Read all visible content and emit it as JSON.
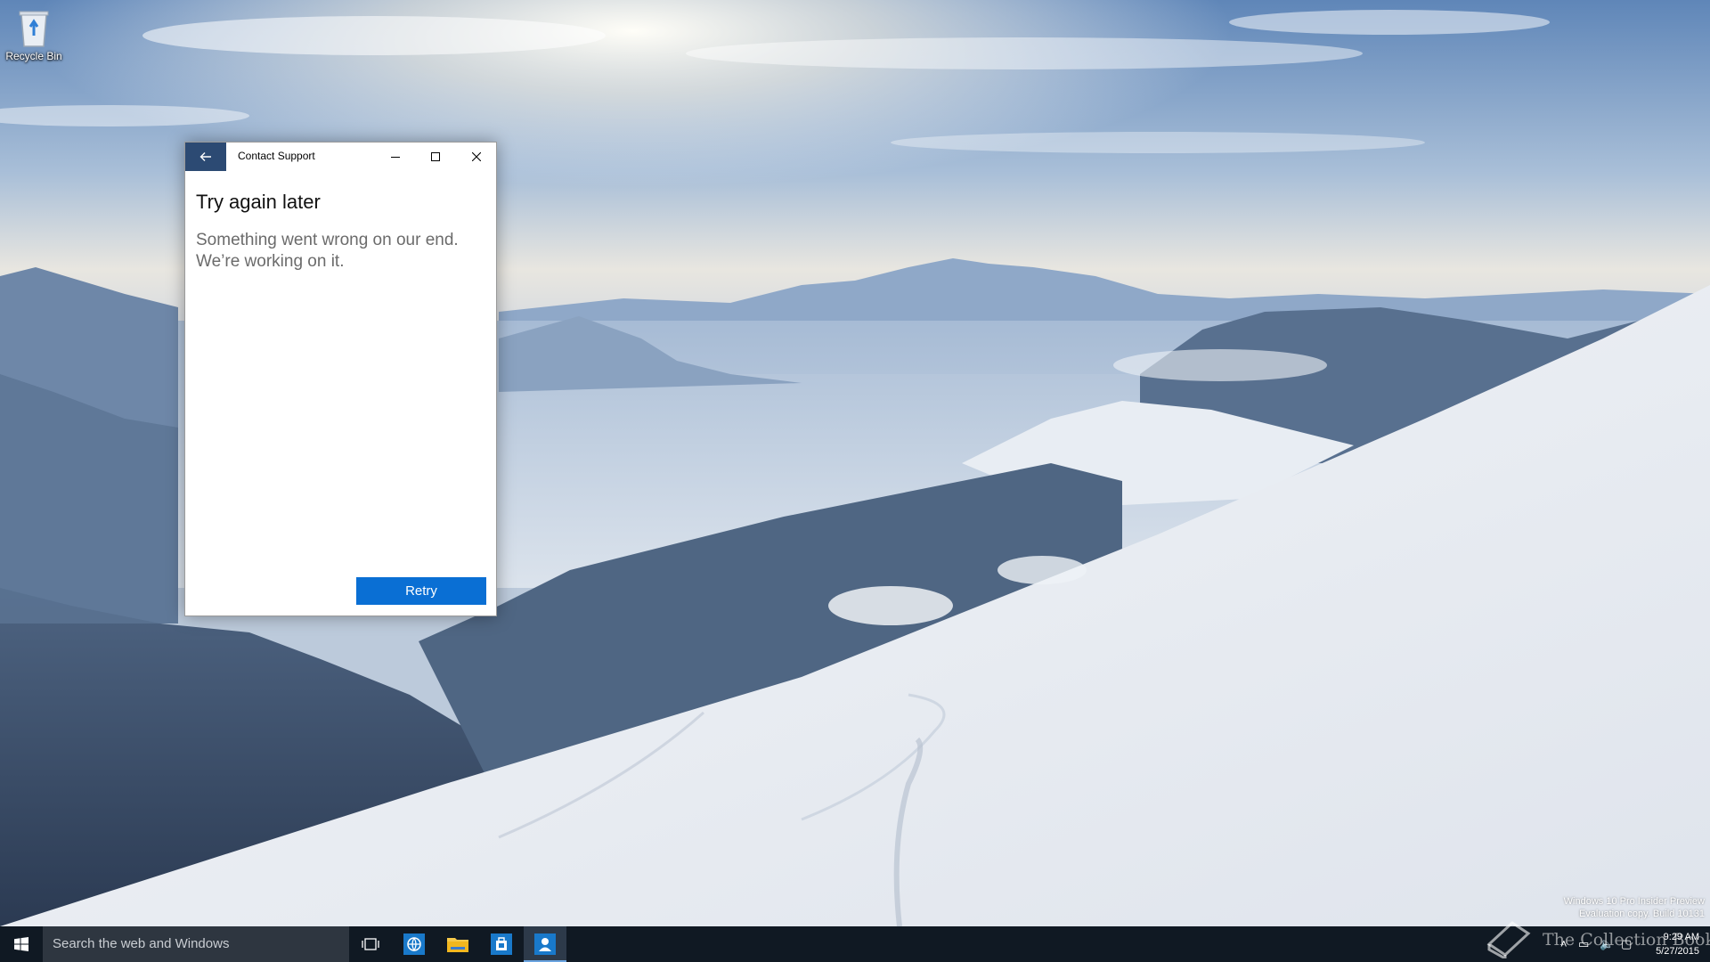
{
  "desktop": {
    "icons": [
      {
        "label": "Recycle Bin",
        "icon": "recycle-bin-icon"
      }
    ]
  },
  "window": {
    "title": "Contact Support",
    "back_icon": "arrow-left-icon",
    "controls": [
      "minimize-icon",
      "maximize-icon",
      "close-icon"
    ],
    "accent_color": "#2c4a73",
    "heading": "Try again later",
    "message_line1": "Something went wrong on our end.",
    "message_line2": "We’re working on it.",
    "retry_label": "Retry",
    "retry_color": "#0a6fd4"
  },
  "taskbar": {
    "start_icon": "windows-logo-icon",
    "search_placeholder": "Search the web and Windows",
    "apps": [
      {
        "name": "task-view",
        "icon": "task-view-icon",
        "active": false
      },
      {
        "name": "edge",
        "icon": "browser-globe-icon",
        "active": false
      },
      {
        "name": "file-explorer",
        "icon": "folder-icon",
        "active": false
      },
      {
        "name": "store",
        "icon": "store-bag-icon",
        "active": false
      },
      {
        "name": "contact-support",
        "icon": "person-icon",
        "active": true
      }
    ],
    "tray": {
      "icons": [
        "chevron-up-icon",
        "network-icon",
        "volume-icon",
        "action-center-icon"
      ],
      "time": "9:29 AM",
      "date": "5/27/2015"
    },
    "background_color": "#101923"
  },
  "watermark": {
    "edition": "Windows 10 Pro Insider Preview",
    "build": "Evaluation copy. Build 10131",
    "brand": "The Collection Book"
  }
}
